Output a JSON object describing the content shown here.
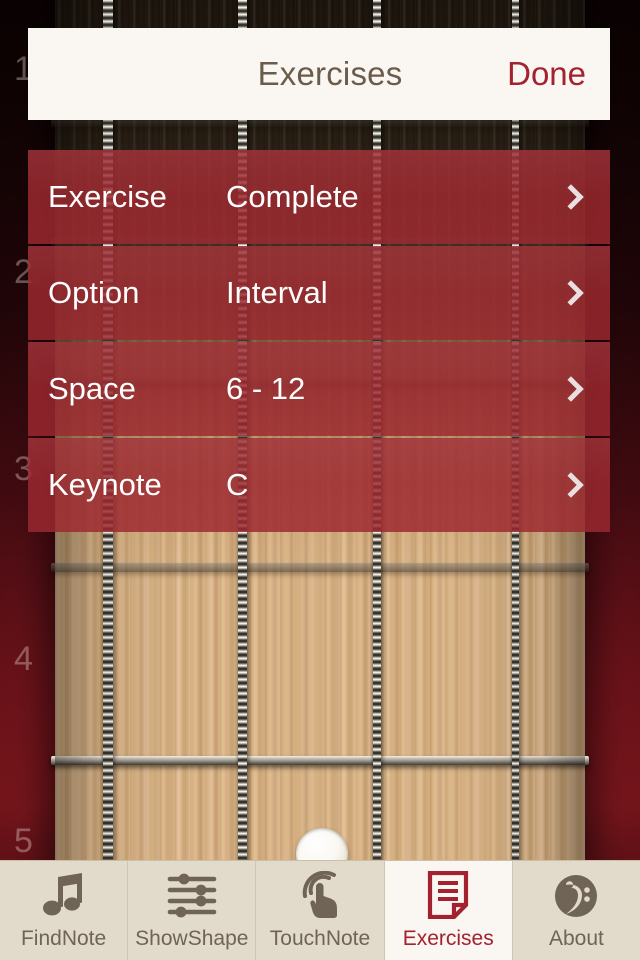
{
  "app": {
    "screen_title": "Exercises"
  },
  "header": {
    "title": "Exercises",
    "done_label": "Done"
  },
  "settings": {
    "rows": [
      {
        "label": "Exercise",
        "value": "Complete",
        "chevron": "chevron-right-icon"
      },
      {
        "label": "Option",
        "value": "Interval",
        "chevron": "chevron-right-icon"
      },
      {
        "label": "Space",
        "value": "6 - 12",
        "chevron": "chevron-right-icon"
      },
      {
        "label": "Keynote",
        "value": "C",
        "chevron": "chevron-right-icon"
      }
    ]
  },
  "fretboard": {
    "fret_numbers": [
      "1",
      "2",
      "3",
      "4",
      "5"
    ],
    "string_count": 4,
    "inlay_dots": 1
  },
  "tabbar": {
    "items": [
      {
        "label": "FindNote",
        "icon": "music-note-icon",
        "active": false
      },
      {
        "label": "ShowShape",
        "icon": "sliders-icon",
        "active": false
      },
      {
        "label": "TouchNote",
        "icon": "touch-hand-icon",
        "active": false
      },
      {
        "label": "Exercises",
        "icon": "document-list-icon",
        "active": true
      },
      {
        "label": "About",
        "icon": "bass-clef-icon",
        "active": false
      }
    ]
  },
  "colors": {
    "accent_red": "#a32230",
    "row_red": "#9c2830",
    "header_cream": "#faf7f2",
    "tabbar_beige": "#e2dacb",
    "tab_label": "#6f6455",
    "title_brown": "#6b5b4b",
    "backdrop_dark_red": "#1a0607",
    "wood_light": "#e6c49b"
  }
}
